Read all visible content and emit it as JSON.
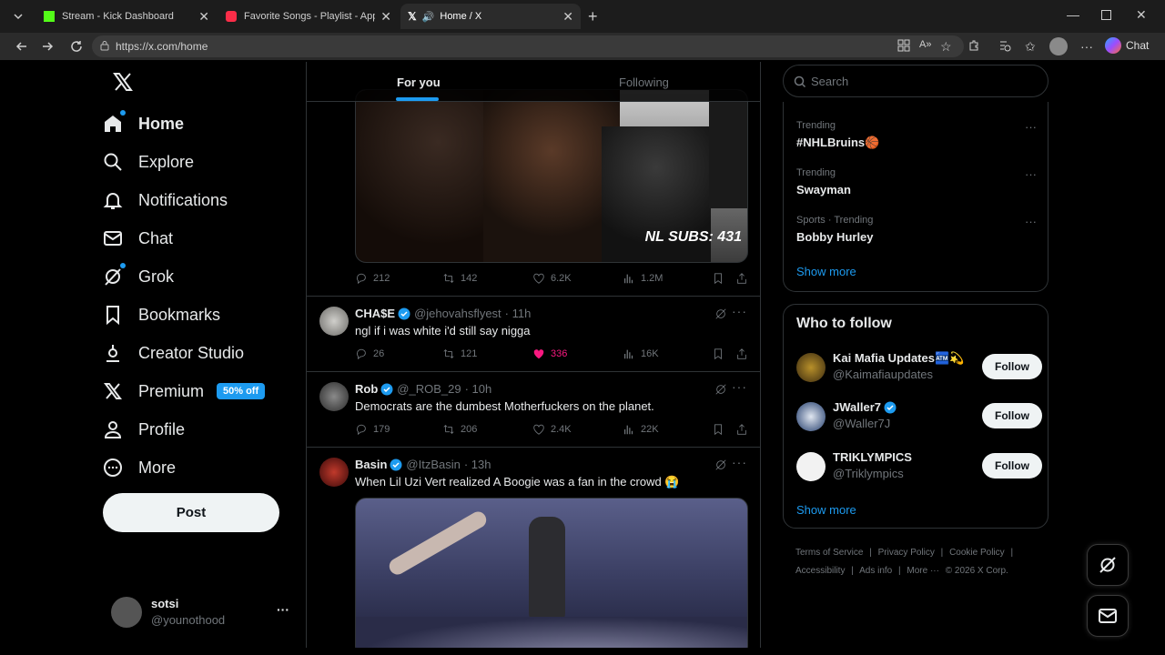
{
  "browser": {
    "tabs": [
      {
        "title": "Stream - Kick Dashboard",
        "icon": "kick-icon"
      },
      {
        "title": "Favorite Songs - Playlist - Apple M",
        "icon": "apple-music-icon"
      },
      {
        "title": "Home / X",
        "icon": "x-logo-icon"
      }
    ],
    "url": "https://x.com/home",
    "chat_label": "Chat"
  },
  "nav": {
    "items": [
      {
        "label": "Home",
        "icon": "home-icon"
      },
      {
        "label": "Explore",
        "icon": "search-icon"
      },
      {
        "label": "Notifications",
        "icon": "bell-icon"
      },
      {
        "label": "Chat",
        "icon": "mail-icon"
      },
      {
        "label": "Grok",
        "icon": "grok-icon"
      },
      {
        "label": "Bookmarks",
        "icon": "bookmark-icon"
      },
      {
        "label": "Creator Studio",
        "icon": "creator-icon"
      },
      {
        "label": "Premium",
        "icon": "x-logo-icon"
      },
      {
        "label": "Profile",
        "icon": "person-icon"
      },
      {
        "label": "More",
        "icon": "more-circle-icon"
      }
    ],
    "premium_badge": "50% off",
    "post_label": "Post",
    "account": {
      "name": "sotsi",
      "handle": "@younothood",
      "more": "···"
    }
  },
  "feed": {
    "tabs": [
      "For you",
      "Following"
    ],
    "tweets": [
      {
        "media_overlay": "NL SUBS: 431",
        "stats": {
          "replies": "212",
          "reposts": "142",
          "likes": "6.2K",
          "views": "1.2M"
        }
      },
      {
        "name": "CHA$E",
        "handle": "@jehovahsflyest",
        "time": "· 11h",
        "text": "ngl if i was white i'd still say nigga",
        "stats": {
          "replies": "26",
          "reposts": "121",
          "likes": "336",
          "views": "16K"
        }
      },
      {
        "name": "Rob",
        "handle": "@_ROB_29",
        "time": "· 10h",
        "text": "Democrats are the dumbest Motherfuckers on the planet.",
        "stats": {
          "replies": "179",
          "reposts": "206",
          "likes": "2.4K",
          "views": "22K"
        }
      },
      {
        "name": "Basin",
        "handle": "@ItzBasin",
        "time": "· 13h",
        "text": "When Lil Uzi Vert realized A Boogie was a fan in the crowd 😭"
      }
    ]
  },
  "sidebar": {
    "search_placeholder": "Search",
    "trends": [
      {
        "context": "Trending",
        "title": "#NHLBruins🏀"
      },
      {
        "context": "Trending",
        "title": "Swayman"
      },
      {
        "context": "Sports · Trending",
        "title": "Bobby Hurley"
      }
    ],
    "trends_show_more": "Show more",
    "who_to_follow": {
      "title": "Who to follow",
      "accounts": [
        {
          "name": "Kai Mafia Updates🏧💫",
          "handle": "@Kaimafiaupdates",
          "button": "Follow"
        },
        {
          "name": "JWaller7",
          "handle": "@Waller7J",
          "button": "Follow"
        },
        {
          "name": "TRIKLYMPICS",
          "handle": "@Triklympics",
          "button": "Follow"
        }
      ],
      "show_more": "Show more"
    },
    "footer": [
      "Terms of Service",
      "|",
      "Privacy Policy",
      "|",
      "Cookie Policy",
      "|",
      "Accessibility",
      "|",
      "Ads info",
      "|",
      "More ···",
      "© 2026 X Corp."
    ]
  },
  "colors": {
    "accent": "#1d9bf0",
    "like": "#f91880",
    "background": "#000000",
    "border": "#2f3336"
  }
}
